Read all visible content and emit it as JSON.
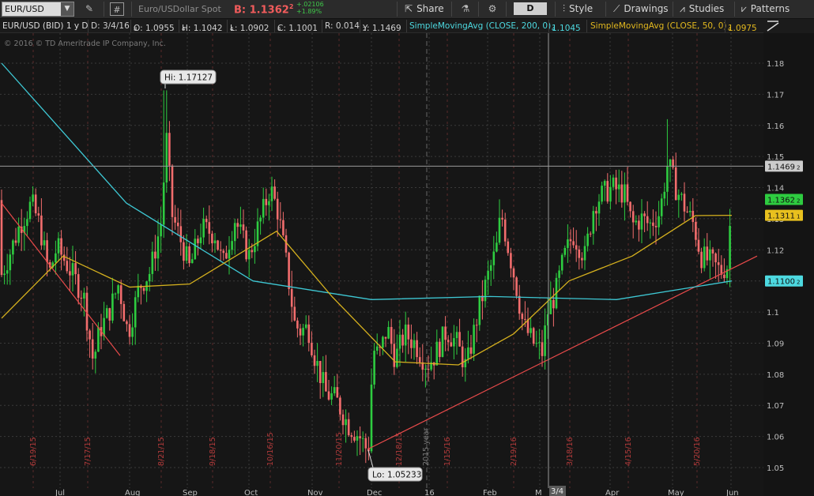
{
  "toolbar": {
    "symbol": "EUR/USD",
    "description": "Euro/USDollar Spot",
    "bid": "B: 1.1362",
    "bid_small": "2",
    "change_abs": "+.02106",
    "change_pct": "+1.89%",
    "share_label": "Share",
    "aggregation": "D",
    "style_label": "Style",
    "drawings_label": "Drawings",
    "studies_label": "Studies",
    "patterns_label": "Patterns",
    "icons": [
      "chevron-down-icon",
      "pencil-icon",
      "hash-icon",
      "share-icon",
      "flask-icon",
      "gear-icon",
      "drawings-icon",
      "studies-icon",
      "patterns-icon"
    ]
  },
  "info_bar": {
    "instrument": "EUR/USD (BID) 1 y D",
    "date": "D: 3/4/16",
    "open": "O: 1.0955",
    "open_s": "8",
    "high": "H: 1.1042",
    "high_s": "4",
    "low": "L: 1.0902",
    "low_s": "4",
    "close": "C: 1.1001",
    "close_s": "6",
    "range": "R: 0.014",
    "yval": "Y: 1.1469",
    "yval_s": "2",
    "sma200_label": "SimpleMovingAvg (CLOSE, 200, 0)",
    "sma200_value": "1.1045",
    "sma200_s": "4",
    "sma50_label": "SimpleMovingAvg (CLOSE, 50, 0)",
    "sma50_value": "1.0975",
    "sma50_s": "4"
  },
  "copyright": "© 2016 © TD Ameritrade IP Company, Inc.",
  "chart_data": {
    "type": "candlestick",
    "title": "EUR/USD (BID) 1 y D",
    "ylim": [
      1.045,
      1.19
    ],
    "y_ticks": [
      "1.18",
      "1.17",
      "1.16",
      "1.15",
      "1.14",
      "1.13",
      "1.12",
      "1.11",
      "1.1",
      "1.09",
      "1.08",
      "1.07",
      "1.06",
      "1.05"
    ],
    "x_ticks": [
      "Jul",
      "Aug",
      "Sep",
      "Oct",
      "Nov",
      "Dec",
      "16",
      "Feb",
      "M",
      "Apr",
      "May",
      "Jun"
    ],
    "vertical_date_labels": [
      "6/19/15",
      "7/17/15",
      "8/21/15",
      "9/18/15",
      "10/16/15",
      "11/20/15",
      "12/18/15",
      "1/15/16",
      "2/19/16",
      "3/18/16",
      "4/15/16",
      "5/20/16"
    ],
    "year_label": "2015 year",
    "cursor_date": "3/4",
    "annotations": {
      "high": "Hi: 1.17127",
      "low": "Lo: 1.05233"
    },
    "price_tags": [
      {
        "value": "1.1469",
        "small": "2",
        "color": "#cccccc"
      },
      {
        "value": "1.1362",
        "small": "2",
        "color": "#2ecc40"
      },
      {
        "value": "1.1311",
        "small": "1",
        "color": "#e8c01e"
      },
      {
        "value": "1.1100",
        "small": "2",
        "color": "#4dd9e0"
      }
    ],
    "series": [
      {
        "name": "EUR/USD",
        "type": "candlestick",
        "start": 1.136,
        "end": 1.1362,
        "high": 1.17127,
        "low": 1.05233
      },
      {
        "name": "SimpleMovingAvg (CLOSE, 200, 0)",
        "color": "#3ec8d4",
        "x": [
          "6/15",
          "8/15",
          "10/15",
          "12/15",
          "2/16",
          "4/16",
          "6/16"
        ],
        "values": [
          1.18,
          1.135,
          1.11,
          1.104,
          1.105,
          1.104,
          1.11
        ]
      },
      {
        "name": "SimpleMovingAvg (CLOSE, 50, 0)",
        "color": "#d6b11e",
        "x": [
          "6/15",
          "7/15",
          "8/15",
          "9/15",
          "10/15",
          "11/15",
          "12/15",
          "1/16",
          "2/16",
          "3/16",
          "4/16",
          "5/16",
          "6/16"
        ],
        "values": [
          1.098,
          1.118,
          1.108,
          1.109,
          1.126,
          1.105,
          1.084,
          1.083,
          1.093,
          1.11,
          1.118,
          1.131,
          1.1311
        ]
      }
    ],
    "trendlines": [
      {
        "color": "#e84a4a",
        "from": [
          "6/15",
          1.135
        ],
        "to": [
          "8/15",
          1.086
        ]
      },
      {
        "color": "#e84a4a",
        "from": [
          "12/15",
          1.056
        ],
        "to": [
          "6/16",
          1.118
        ]
      }
    ],
    "crosshair": {
      "y": 1.1469,
      "x": "3/4/16"
    },
    "colors": {
      "up": "#2ecc40",
      "down": "#f26d6d",
      "grid": "#3a3a3a",
      "sma200": "#3ec8d4",
      "sma50": "#d6b11e",
      "trend": "#e84a4a"
    }
  }
}
